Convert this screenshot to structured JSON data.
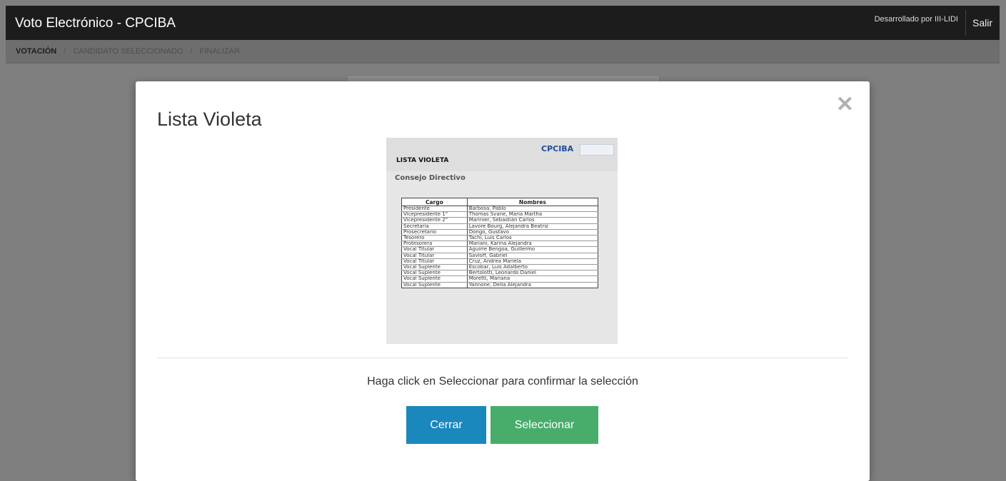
{
  "header": {
    "app_title": "Voto Electrónico - CPCIBA",
    "developer_credit": "Desarrollado por III-LIDI",
    "logout_label": "Salir"
  },
  "breadcrumb": {
    "items": [
      "VOTACIÓN",
      "CANDIDATO SELECCIONADO",
      "FINALIZAR"
    ],
    "separator": "/"
  },
  "modal": {
    "title": "Lista Violeta",
    "close_glyph": "✕",
    "document": {
      "logo_text": "CPCIBA",
      "list_name": "LISTA VIOLETA",
      "section": "Consejo Directivo",
      "columns": [
        "Cargo",
        "Nombres"
      ],
      "rows": [
        [
          "Presidente",
          "Barbosa, Pablo"
        ],
        [
          "Vicepresidente 1°",
          "Thomas Svane, María Martha"
        ],
        [
          "Vicepresidente 2°",
          "Marinier, Sebastián Carlos"
        ],
        [
          "Secretaria",
          "Lavore Bourg, Alejandra Beatriz"
        ],
        [
          "Prosecretario",
          "Dongo, Gustavo"
        ],
        [
          "Tesorero",
          "Tachi, Luis Carlos"
        ],
        [
          "Protesorera",
          "Mariani, Karina Alejandra"
        ],
        [
          "Vocal Titular",
          "Aguirre Bengoa, Guillermo"
        ],
        [
          "Vocal Titular",
          "Savloff, Gabriel"
        ],
        [
          "Vocal Titular",
          "Cruz, Andrea Mariela"
        ],
        [
          "Vocal Suplente",
          "Escobar, Luis Adalberto"
        ],
        [
          "Vocal Suplente",
          "Bertolotti, Leonardo Daniel"
        ],
        [
          "Vocal Suplente",
          "Moretti, Mariana"
        ],
        [
          "Vocal Suplente",
          "Yannone, Delia Alejandra"
        ]
      ]
    },
    "confirm_text": "Haga click en Seleccionar para confirmar la selección",
    "buttons": {
      "close_label": "Cerrar",
      "select_label": "Seleccionar"
    }
  },
  "colors": {
    "topbar": "#1c1c1c",
    "close_button": "#1a87bd",
    "select_button": "#48ad6b",
    "overlay": "#7f7f7f"
  }
}
